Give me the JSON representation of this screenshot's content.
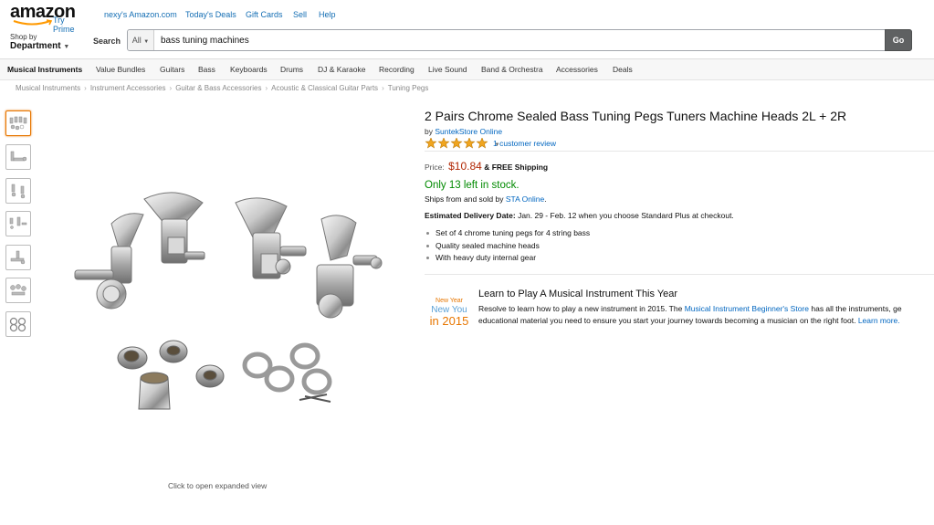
{
  "header": {
    "logo_text": "amazon",
    "try_prime": "Try Prime",
    "nav_links": [
      "nexy's Amazon.com",
      "Today's Deals",
      "Gift Cards",
      "Sell",
      "Help"
    ],
    "shop_by": "Shop by",
    "department": "Department",
    "search_label": "Search",
    "search_scope": "All",
    "search_value": "bass tuning machines",
    "go_label": "Go"
  },
  "subnav": {
    "items": [
      "Musical Instruments",
      "Value Bundles",
      "Guitars",
      "Bass",
      "Keyboards",
      "Drums",
      "DJ & Karaoke",
      "Recording",
      "Live Sound",
      "Band & Orchestra",
      "Accessories",
      "Deals"
    ]
  },
  "breadcrumb": [
    "Musical Instruments",
    "Instrument Accessories",
    "Guitar & Bass Accessories",
    "Acoustic & Classical Guitar Parts",
    "Tuning Pegs"
  ],
  "gallery": {
    "expand_text": "Click to open expanded view",
    "thumb_count": 7,
    "selected_index": 0
  },
  "product": {
    "title": "2 Pairs Chrome Sealed Bass Tuning Pegs Tuners Machine Heads 2L + 2R",
    "by": "by",
    "seller": "SuntekStore Online",
    "rating": 5,
    "review_text": "1 customer review",
    "price_label": "Price:",
    "price": "$10.84",
    "shipping": "& FREE Shipping",
    "stock": "Only 13 left in stock.",
    "ships_from_prefix": "Ships from and sold by",
    "ships_from_seller": "STA Online",
    "ships_from_suffix": ".",
    "delivery_label": "Estimated Delivery Date:",
    "delivery_text": "Jan. 29 - Feb. 12 when you choose Standard Plus at checkout.",
    "bullets": [
      "Set of 4 chrome tuning pegs for 4 string bass",
      "Quality sealed machine heads",
      "With heavy duty internal gear"
    ]
  },
  "promo": {
    "logo_line1": "New Year",
    "logo_line2": "New You",
    "logo_line3": "in 2015",
    "heading": "Learn to Play A Musical Instrument This Year",
    "body_prefix": "Resolve to learn how to play a new instrument in 2015. The",
    "body_link": "Musical Instrument Beginner's Store",
    "body_suffix": "has all the instruments, ge",
    "body_line2": "educational material you need to ensure you start your journey towards becoming a musician on the right foot.",
    "learn_more": "Learn more."
  },
  "colors": {
    "price": "#b12704",
    "stock": "#008a00",
    "link": "#0066c0",
    "star": "#f0a51f",
    "accent": "#e77600"
  }
}
